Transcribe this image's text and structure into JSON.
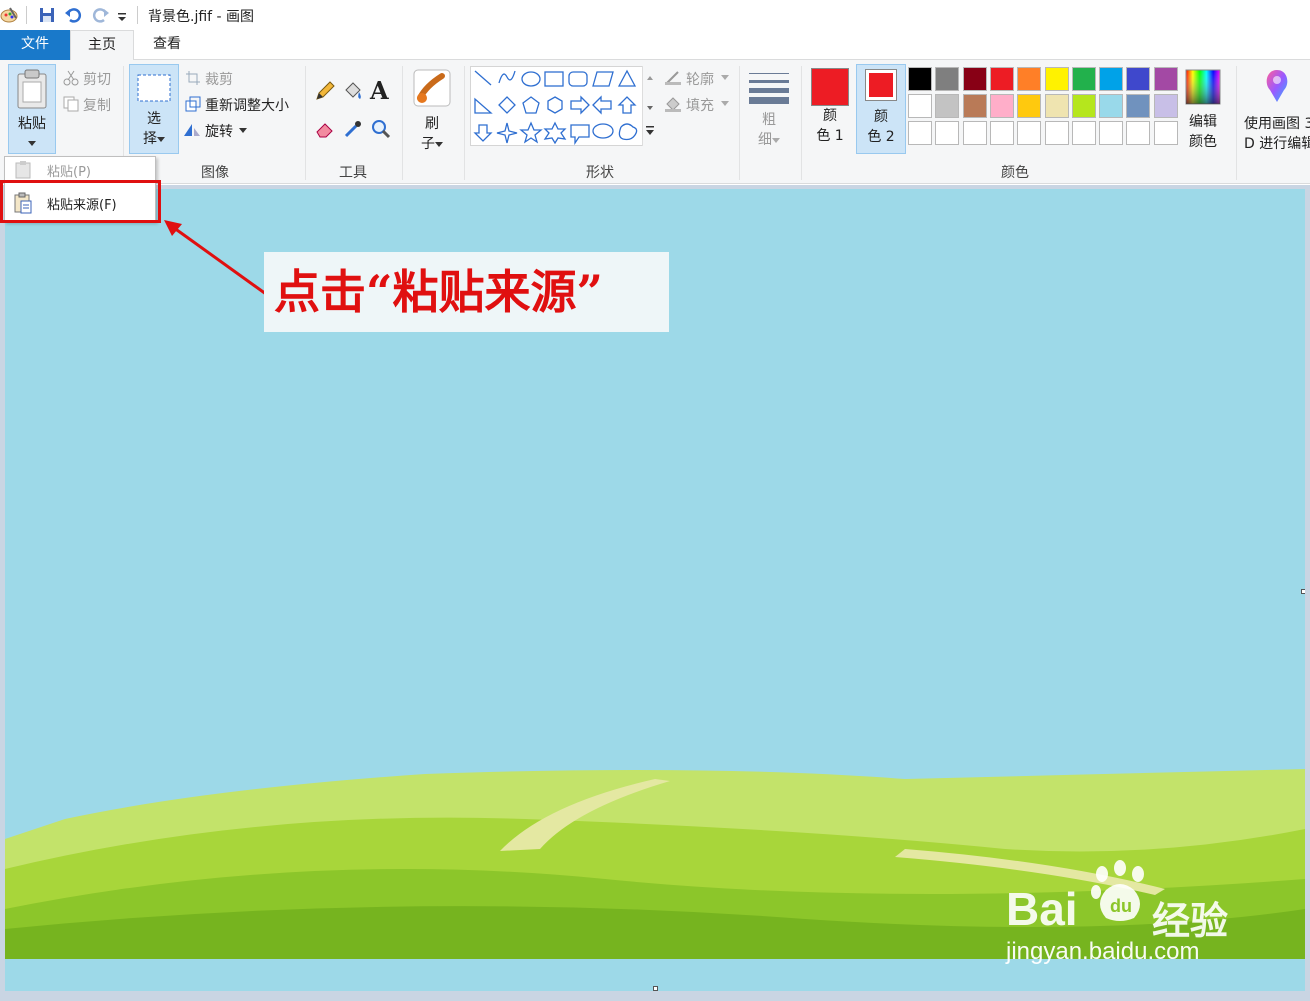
{
  "window": {
    "title": "背景色.jfif - 画图"
  },
  "tabs": [
    {
      "label": "文件"
    },
    {
      "label": "主页"
    },
    {
      "label": "查看"
    }
  ],
  "clipboard": {
    "paste_label": "粘贴",
    "cut_label": "剪切",
    "copy_label": "复制",
    "group_label": ""
  },
  "image": {
    "select_label_1": "选",
    "select_label_2": "择",
    "crop_label": "裁剪",
    "resize_label": "重新调整大小",
    "rotate_label": "旋转",
    "group_label": "图像"
  },
  "tools": {
    "group_label": "工具",
    "text_glyph": "A"
  },
  "brushes": {
    "label_1": "刷",
    "label_2": "子"
  },
  "shapes": {
    "group_label": "形状",
    "outline_label": "轮廓",
    "fill_label": "填充"
  },
  "size": {
    "label_1": "粗",
    "label_2": "细"
  },
  "colors": {
    "color1_label_1": "颜",
    "color1_label_2": "色 1",
    "color2_label_1": "颜",
    "color2_label_2": "色 2",
    "edit_label_1": "编辑",
    "edit_label_2": "颜色",
    "group_label": "颜色",
    "color1": "#ed1c24",
    "color2": "#ed1c24",
    "palette_row1": [
      "#000000",
      "#7f7f7f",
      "#880015",
      "#ed1c24",
      "#ff7f27",
      "#fff200",
      "#22b14c",
      "#00a2e8",
      "#3f48cc",
      "#a349a4"
    ],
    "palette_row2": [
      "#ffffff",
      "#c3c3c3",
      "#b97a57",
      "#ffaec9",
      "#ffc90e",
      "#efe4b0",
      "#b5e61d",
      "#99d9ea",
      "#7092be",
      "#c8bfe7"
    ]
  },
  "paint3d": {
    "label_1": "使用画图 3",
    "label_2": "D 进行编辑"
  },
  "dropdown": {
    "disabled_item": "粘贴(P)",
    "item": "粘贴来源(F)"
  },
  "callout": {
    "text": "点击“粘贴来源”"
  },
  "watermark": {
    "brand": "Bai",
    "brand2": "经验",
    "url": "jingyan.baidu.com"
  }
}
